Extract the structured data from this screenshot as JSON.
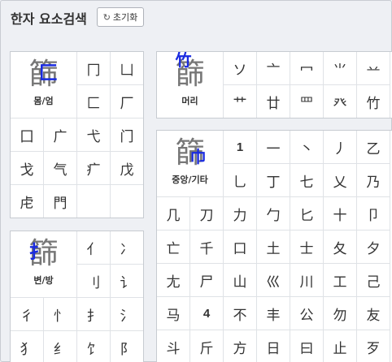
{
  "header": {
    "title": "한자 요소검색",
    "reset_label": "초기화",
    "reset_icon": "refresh-icon"
  },
  "colors": {
    "highlight": "#1a2be0",
    "border": "#c7cbd1",
    "bg": "#eef0f4"
  },
  "enclosure": {
    "hero": {
      "char": "篩",
      "highlight": "匚",
      "label": "몸/엄"
    },
    "chars": [
      "冂",
      "凵",
      "匚",
      "厂",
      "囗",
      "广",
      "弋",
      "门",
      "戈",
      "气",
      "疒",
      "戊",
      "虍",
      "門",
      "",
      ""
    ]
  },
  "head": {
    "hero": {
      "char": "篩",
      "highlight": "竹",
      "label": "머리"
    },
    "chars": [
      "ソ",
      "亠",
      "冖",
      "⺌",
      "䒑",
      "艹",
      "廿",
      "罒",
      "癶",
      "竹"
    ]
  },
  "middle": {
    "hero": {
      "char": "篩",
      "highlight": "巾",
      "label": "중앙/기타"
    },
    "rows": [
      [
        "",
        "",
        "1",
        "一",
        "丶",
        "丿",
        "乙"
      ],
      [
        "",
        "",
        "乚",
        "丁",
        "七",
        "乂",
        "乃"
      ],
      [
        "几",
        "刀",
        "力",
        "勹",
        "匕",
        "十",
        "卩"
      ],
      [
        "亡",
        "千",
        "口",
        "土",
        "士",
        "夂",
        "夕"
      ],
      [
        "尢",
        "尸",
        "山",
        "巛",
        "川",
        "工",
        "己"
      ],
      [
        "马",
        "4",
        "不",
        "丰",
        "公",
        "勿",
        "友"
      ],
      [
        "斗",
        "斤",
        "方",
        "日",
        "曰",
        "止",
        "歹"
      ]
    ]
  },
  "side": {
    "hero": {
      "char": "篩",
      "highlight": "扌",
      "label": "변/방"
    },
    "rows": [
      [
        "",
        "",
        "亻",
        "冫"
      ],
      [
        "",
        "",
        "刂",
        "讠"
      ],
      [
        "彳",
        "忄",
        "扌",
        "氵"
      ],
      [
        "犭",
        "纟",
        "饣",
        "阝"
      ]
    ]
  }
}
